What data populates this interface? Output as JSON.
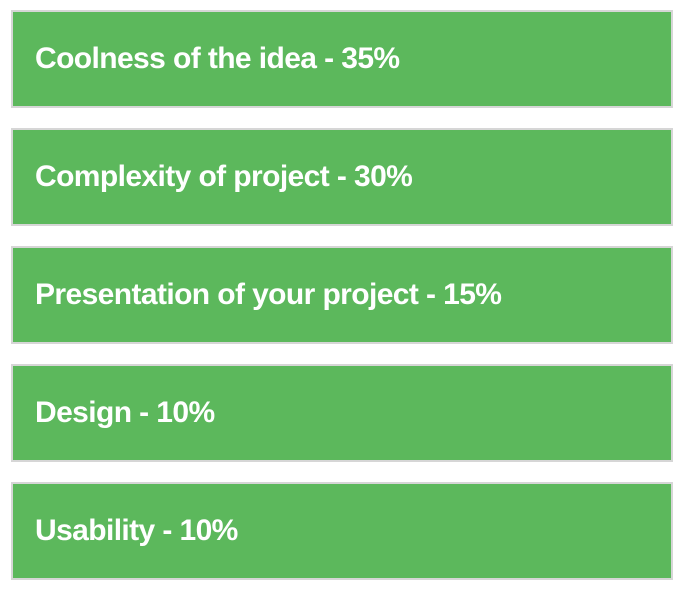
{
  "accent_color": "#5cb85c",
  "border_color": "#d6d6d6",
  "separator": " - ",
  "criteria": [
    {
      "name": "Coolness of the idea",
      "weight": "35%"
    },
    {
      "name": "Complexity of project",
      "weight": "30%"
    },
    {
      "name": "Presentation of your project",
      "weight": "15%"
    },
    {
      "name": "Design",
      "weight": "10%"
    },
    {
      "name": "Usability",
      "weight": "10%"
    }
  ]
}
